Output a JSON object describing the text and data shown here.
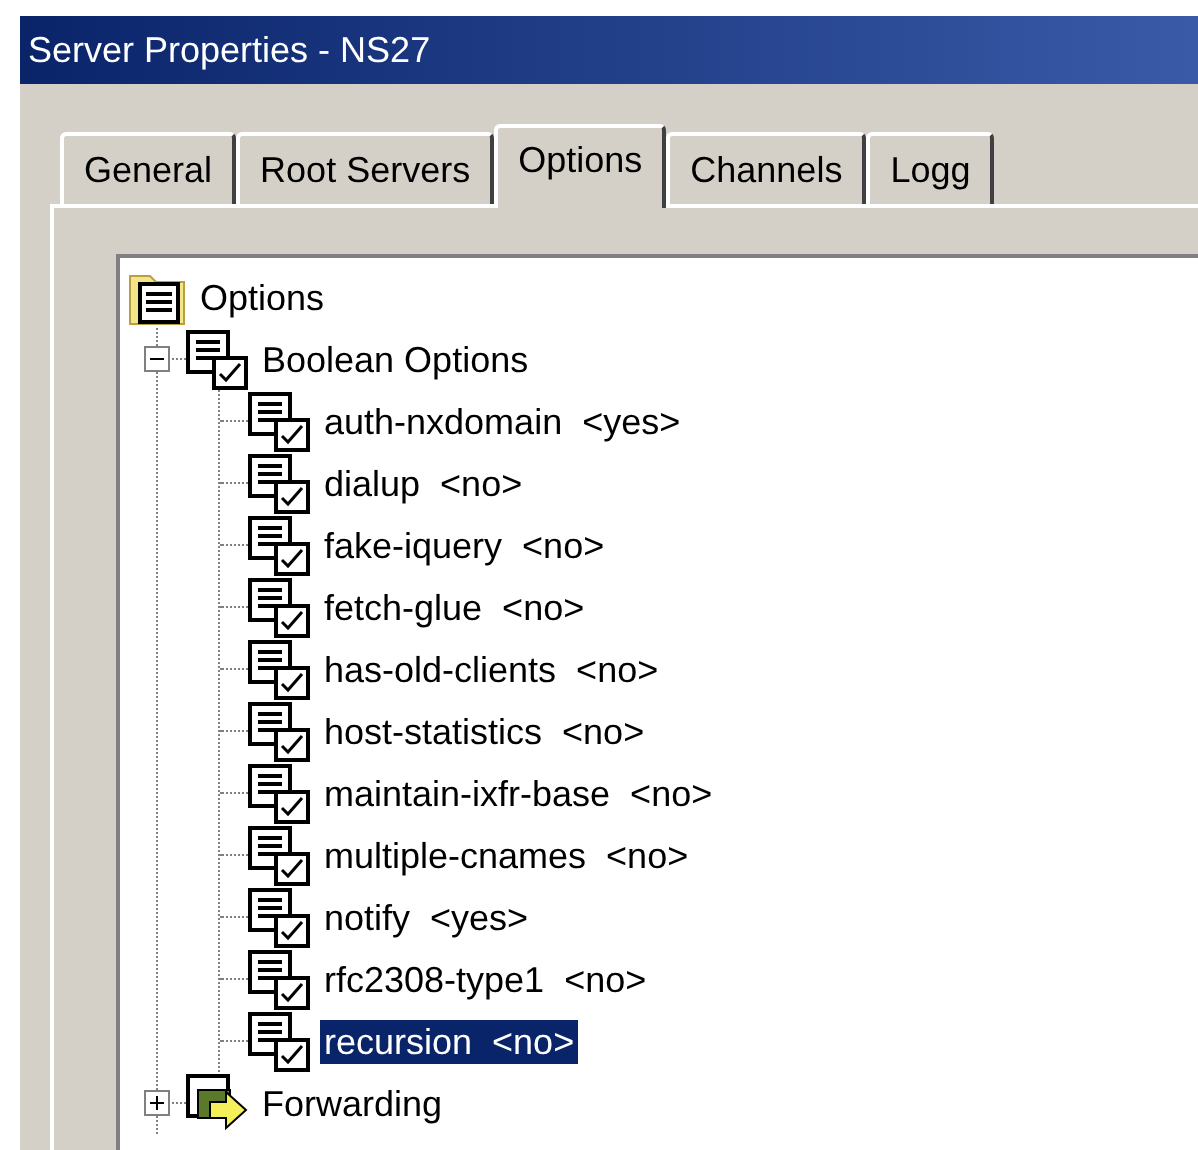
{
  "window": {
    "title": "Server Properties - NS27"
  },
  "tabs": [
    {
      "label": "General",
      "selected": false
    },
    {
      "label": "Root Servers",
      "selected": false
    },
    {
      "label": "Options",
      "selected": true
    },
    {
      "label": "Channels",
      "selected": false
    },
    {
      "label": "Logg",
      "selected": false
    }
  ],
  "tree": [
    {
      "label": "Options",
      "kind": "root",
      "selected": false,
      "children": [
        {
          "label": "Boolean Options",
          "kind": "group",
          "expanded": true,
          "selected": false,
          "children": [
            {
              "label": "auth-nxdomain  <yes>",
              "kind": "option",
              "selected": false
            },
            {
              "label": "dialup  <no>",
              "kind": "option",
              "selected": false
            },
            {
              "label": "fake-iquery  <no>",
              "kind": "option",
              "selected": false
            },
            {
              "label": "fetch-glue  <no>",
              "kind": "option",
              "selected": false
            },
            {
              "label": "has-old-clients  <no>",
              "kind": "option",
              "selected": false
            },
            {
              "label": "host-statistics  <no>",
              "kind": "option",
              "selected": false
            },
            {
              "label": "maintain-ixfr-base  <no>",
              "kind": "option",
              "selected": false
            },
            {
              "label": "multiple-cnames  <no>",
              "kind": "option",
              "selected": false
            },
            {
              "label": "notify  <yes>",
              "kind": "option",
              "selected": false
            },
            {
              "label": "rfc2308-type1  <no>",
              "kind": "option",
              "selected": false
            },
            {
              "label": "recursion  <no>",
              "kind": "option",
              "selected": true
            }
          ]
        },
        {
          "label": "Forwarding",
          "kind": "forward",
          "expanded": false,
          "selected": false
        }
      ]
    }
  ]
}
